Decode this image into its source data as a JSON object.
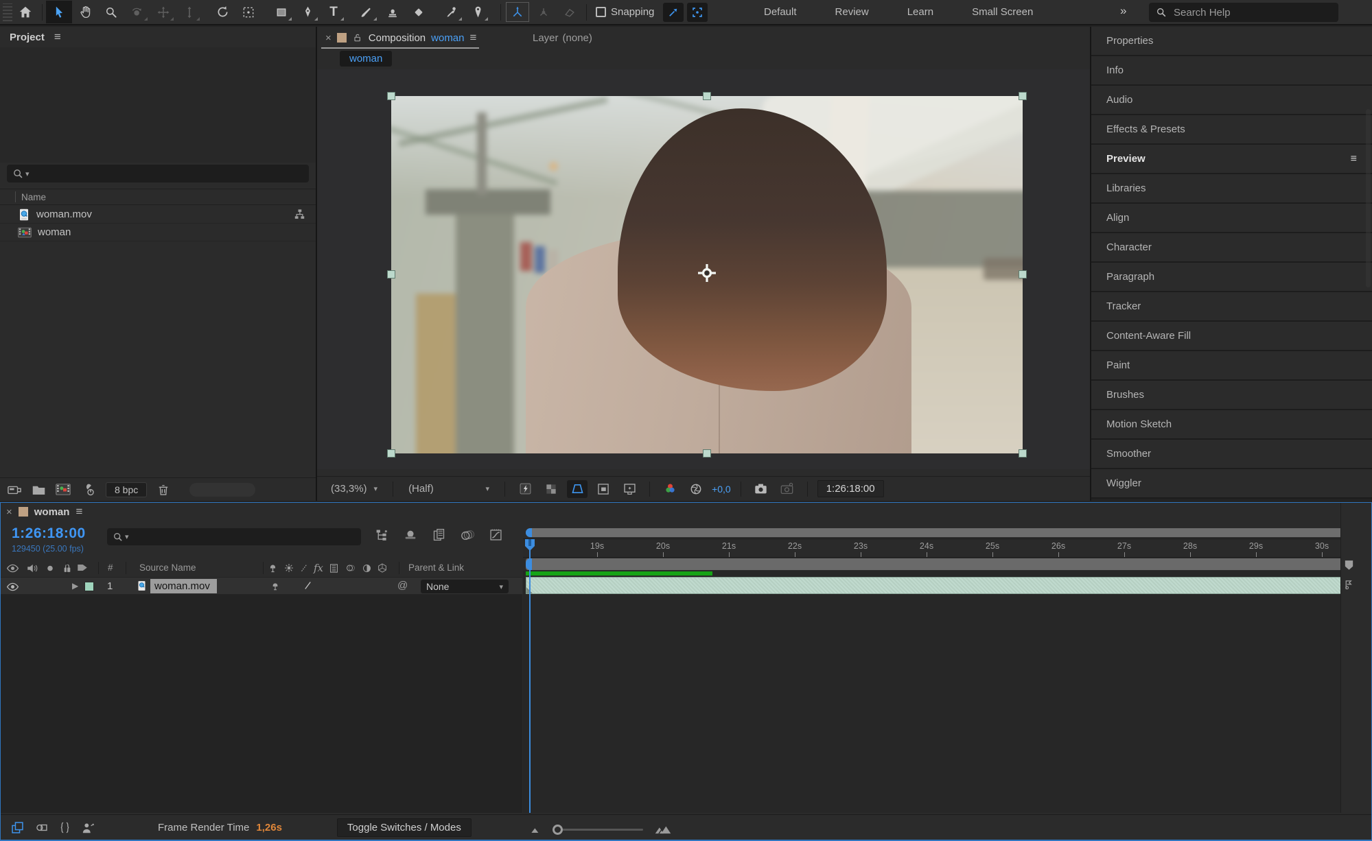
{
  "toolbar": {
    "snapping_label": "Snapping",
    "workspaces": [
      "Default",
      "Review",
      "Learn",
      "Small Screen"
    ],
    "overflow": "»",
    "search_placeholder": "Search Help"
  },
  "project": {
    "title": "Project",
    "name_column": "Name",
    "items": [
      {
        "name": "woman.mov",
        "type": "quicktime-footage"
      },
      {
        "name": "woman",
        "type": "composition"
      }
    ],
    "bpc_label": "8 bpc"
  },
  "composition": {
    "close": "×",
    "tab_label": "Composition",
    "tab_name": "woman",
    "layer_tab_label": "Layer",
    "layer_tab_value": "(none)",
    "breadcrumb": "woman",
    "zoom_value": "(33,3%)",
    "resolution_value": "(Half)",
    "exposure_value": "+0,0",
    "timecode": "1:26:18:00"
  },
  "right_panel": {
    "active": "Preview",
    "menu_glyph": "≡",
    "items": [
      "Properties",
      "Info",
      "Audio",
      "Effects & Presets",
      "Preview",
      "Libraries",
      "Align",
      "Character",
      "Paragraph",
      "Tracker",
      "Content-Aware Fill",
      "Paint",
      "Brushes",
      "Motion Sketch",
      "Smoother",
      "Wiggler"
    ]
  },
  "timeline": {
    "close": "×",
    "tab_name": "woman",
    "menu_glyph": "≡",
    "timecode": "1:26:18:00",
    "frame_info": "129450 (25.00 fps)",
    "columns": {
      "index": "#",
      "source_name": "Source Name",
      "parent_link": "Parent & Link"
    },
    "ruler_labels": [
      "19s",
      "20s",
      "21s",
      "22s",
      "23s",
      "24s",
      "25s",
      "26s",
      "27s",
      "28s",
      "29s",
      "30s"
    ],
    "layer": {
      "number": "1",
      "name": "woman.mov",
      "parent_value": "None"
    },
    "footer": {
      "frame_render_label": "Frame Render Time",
      "frame_render_value": "1,26s",
      "toggle_label": "Toggle Switches / Modes"
    }
  },
  "colors": {
    "accent_blue": "#3f96f4",
    "selection_handle": "#bcd9cc",
    "layer_bar": "#bdd8cb",
    "cache_green": "#16a316",
    "render_time_orange": "#e0873a",
    "comp_tab_square": "#bfa183"
  }
}
